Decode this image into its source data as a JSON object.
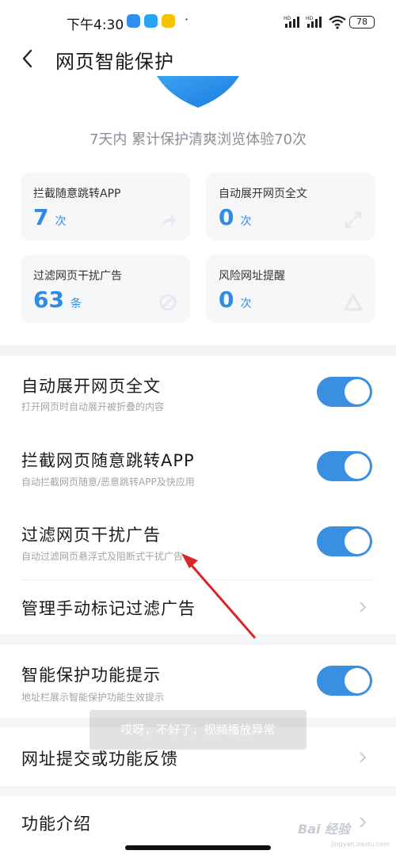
{
  "status_bar": {
    "time": "下午4:30",
    "battery": "78",
    "network_label": "HD",
    "icons": [
      "kuaishou-icon",
      "message-icon",
      "app-icon",
      "signal-icon",
      "wifi-icon",
      "battery-icon"
    ]
  },
  "header": {
    "title": "网页智能保护"
  },
  "summary": "7天内 累计保护清爽浏览体验70次",
  "stats": [
    {
      "label": "拦截随意跳转APP",
      "value": "7",
      "unit": "次",
      "icon": "redirect-icon"
    },
    {
      "label": "自动展开网页全文",
      "value": "0",
      "unit": "次",
      "icon": "expand-icon"
    },
    {
      "label": "过滤网页干扰广告",
      "value": "63",
      "unit": "条",
      "icon": "block-ad-icon"
    },
    {
      "label": "风险网址提醒",
      "value": "0",
      "unit": "次",
      "icon": "warning-icon"
    }
  ],
  "settings": [
    {
      "title": "自动展开网页全文",
      "subtitle": "打开网页时自动展开被折叠的内容",
      "enabled": true
    },
    {
      "title": "拦截网页随意跳转APP",
      "subtitle": "自动拦截网页随意/恶意跳转APP及快应用",
      "enabled": true
    },
    {
      "title": "过滤网页干扰广告",
      "subtitle": "自动过滤网页悬浮式及阻断式干扰广告",
      "enabled": true
    }
  ],
  "manage_label": "管理手动标记过滤广告",
  "smart_tip": {
    "title": "智能保护功能提示",
    "subtitle": "地址栏展示智能保护功能生效提示",
    "enabled": true
  },
  "feedback_label": "网址提交或功能反馈",
  "intro_label": "功能介绍",
  "toast": "哎呀，不好了，视频播放异常",
  "watermark": {
    "brand": "Bai 经验",
    "url": "jingyan.baidu.com"
  },
  "colors": {
    "accent": "#2f8be6",
    "toggle_on": "#3a8fe0",
    "annotation_arrow": "#d8262a"
  }
}
